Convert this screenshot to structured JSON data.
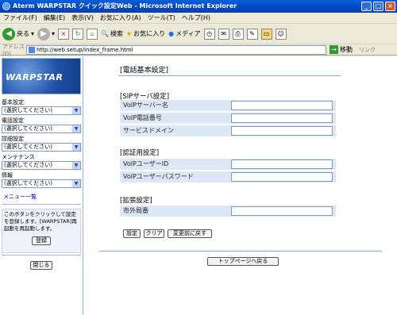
{
  "window": {
    "title": "Aterm WARPSTAR クイック設定Web - Microsoft Internet Explorer"
  },
  "menubar": [
    "ファイル(F)",
    "編集(E)",
    "表示(V)",
    "お気に入り(A)",
    "ツール(T)",
    "ヘルプ(H)"
  ],
  "toolbar": {
    "back": "戻る",
    "search": "検索",
    "favorites": "お気に入り",
    "media": "メディア"
  },
  "address": {
    "label": "アドレス(D)",
    "url": "http://web.setup/index_frame.html",
    "go": "移動",
    "links": "リンク"
  },
  "sidebar": {
    "logo": "WARPSTAR",
    "groups": [
      {
        "label": "基本設定",
        "selected": "(選択してください)"
      },
      {
        "label": "電話設定",
        "selected": "(選択してください)"
      },
      {
        "label": "詳細設定",
        "selected": "(選択してください)"
      },
      {
        "label": "メンテナンス",
        "selected": "(選択してください)"
      },
      {
        "label": "情報",
        "selected": "(選択してください)"
      }
    ],
    "menu_list": "メニュー一覧",
    "note": "このボタンをクリックして設定を登録します。[WARPSTAR]再起動を再起動します。",
    "register": "登録",
    "close": "閉じる"
  },
  "main": {
    "title": "[電話基本設定]",
    "sections": [
      {
        "heading": "[SIPサーバ設定]",
        "fields": [
          "VoIPサーバー名",
          "VoIP電話番号",
          "サービスドメイン"
        ]
      },
      {
        "heading": "[認証用設定]",
        "fields": [
          "VoIPユーザーID",
          "VoIPユーザーパスワード"
        ]
      },
      {
        "heading": "[拡張設定]",
        "fields": [
          "市外局番"
        ]
      }
    ],
    "buttons": {
      "set": "設定",
      "clear": "クリア",
      "revert": "変更前に戻す"
    },
    "top_link": "トップページへ戻る"
  }
}
